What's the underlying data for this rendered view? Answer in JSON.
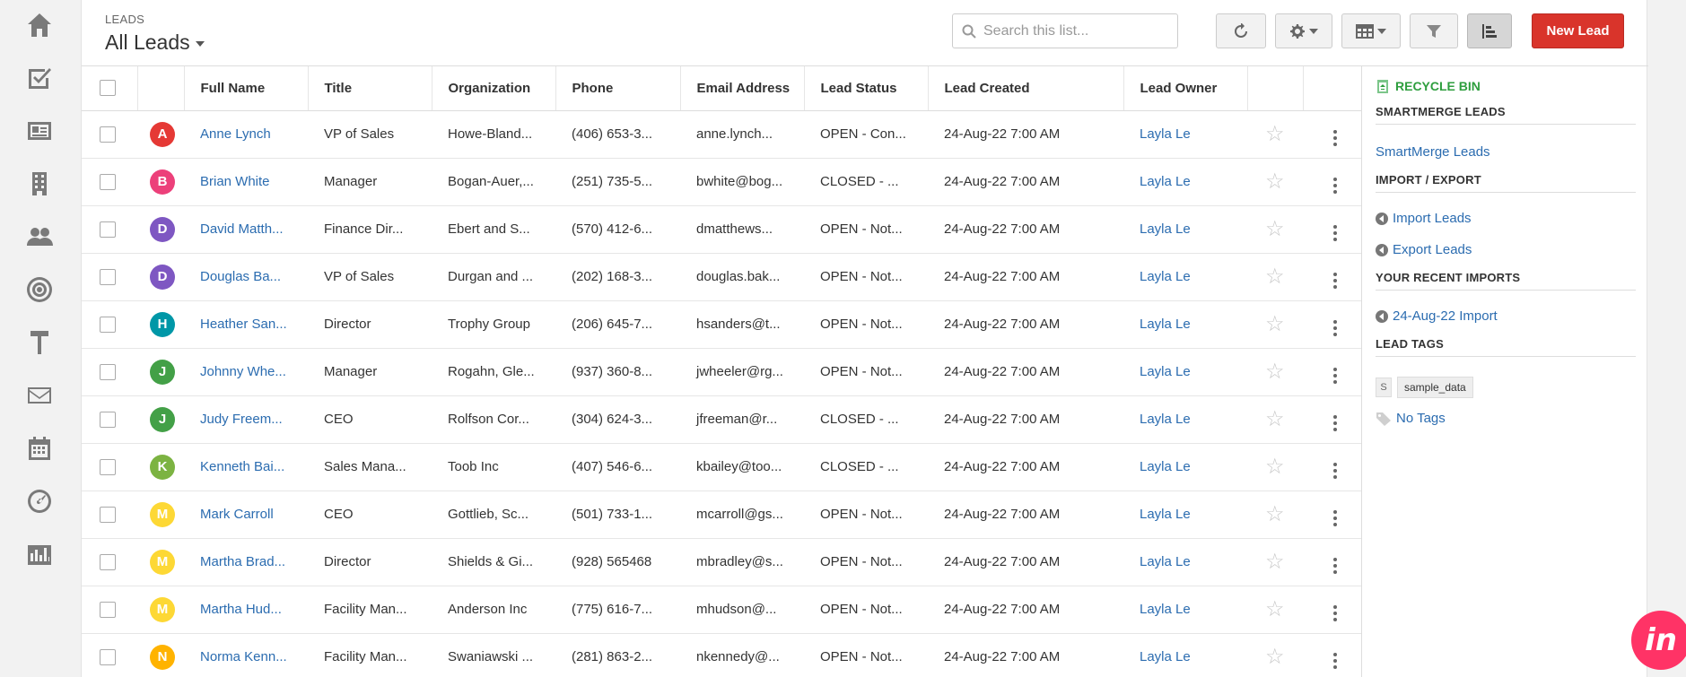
{
  "sidebar": {
    "items": [
      {
        "name": "home-icon"
      },
      {
        "name": "tasks-icon"
      },
      {
        "name": "contacts-icon"
      },
      {
        "name": "companies-icon"
      },
      {
        "name": "people-icon"
      },
      {
        "name": "target-icon"
      },
      {
        "name": "tools-icon"
      },
      {
        "name": "mail-icon"
      },
      {
        "name": "calendar-icon"
      },
      {
        "name": "dashboard-icon"
      },
      {
        "name": "reports-icon"
      }
    ]
  },
  "header": {
    "eyebrow": "LEADS",
    "view_title": "All Leads",
    "search_placeholder": "Search this list...",
    "new_lead_label": "New Lead"
  },
  "table": {
    "columns": [
      "Full Name",
      "Title",
      "Organization",
      "Phone",
      "Email Address",
      "Lead Status",
      "Lead Created",
      "Lead Owner"
    ],
    "rows": [
      {
        "initial": "A",
        "color": "#e53935",
        "name": "Anne Lynch",
        "title": "VP of Sales",
        "org": "Howe-Bland...",
        "phone": "(406) 653-3...",
        "email": "anne.lynch...",
        "status": "OPEN - Con...",
        "created": "24-Aug-22 7:00 AM",
        "owner": "Layla Le"
      },
      {
        "initial": "B",
        "color": "#ec407a",
        "name": "Brian White",
        "title": "Manager",
        "org": "Bogan-Auer,...",
        "phone": "(251) 735-5...",
        "email": "bwhite@bog...",
        "status": "CLOSED - ...",
        "created": "24-Aug-22 7:00 AM",
        "owner": "Layla Le"
      },
      {
        "initial": "D",
        "color": "#7e57c2",
        "name": "David Matth...",
        "title": "Finance Dir...",
        "org": "Ebert and S...",
        "phone": "(570) 412-6...",
        "email": "dmatthews...",
        "status": "OPEN - Not...",
        "created": "24-Aug-22 7:00 AM",
        "owner": "Layla Le"
      },
      {
        "initial": "D",
        "color": "#7e57c2",
        "name": "Douglas Ba...",
        "title": "VP of Sales",
        "org": "Durgan and ...",
        "phone": "(202) 168-3...",
        "email": "douglas.bak...",
        "status": "OPEN - Not...",
        "created": "24-Aug-22 7:00 AM",
        "owner": "Layla Le"
      },
      {
        "initial": "H",
        "color": "#0097a7",
        "name": "Heather San...",
        "title": "Director",
        "org": "Trophy Group",
        "phone": "(206) 645-7...",
        "email": "hsanders@t...",
        "status": "OPEN - Not...",
        "created": "24-Aug-22 7:00 AM",
        "owner": "Layla Le"
      },
      {
        "initial": "J",
        "color": "#43a047",
        "name": "Johnny Whe...",
        "title": "Manager",
        "org": "Rogahn, Gle...",
        "phone": "(937) 360-8...",
        "email": "jwheeler@rg...",
        "status": "OPEN - Not...",
        "created": "24-Aug-22 7:00 AM",
        "owner": "Layla Le"
      },
      {
        "initial": "J",
        "color": "#43a047",
        "name": "Judy Freem...",
        "title": "CEO",
        "org": "Rolfson Cor...",
        "phone": "(304) 624-3...",
        "email": "jfreeman@r...",
        "status": "CLOSED - ...",
        "created": "24-Aug-22 7:00 AM",
        "owner": "Layla Le"
      },
      {
        "initial": "K",
        "color": "#7cb342",
        "name": "Kenneth Bai...",
        "title": "Sales Mana...",
        "org": "Toob Inc",
        "phone": "(407) 546-6...",
        "email": "kbailey@too...",
        "status": "CLOSED - ...",
        "created": "24-Aug-22 7:00 AM",
        "owner": "Layla Le"
      },
      {
        "initial": "M",
        "color": "#fdd835",
        "name": "Mark Carroll",
        "title": "CEO",
        "org": "Gottlieb, Sc...",
        "phone": "(501) 733-1...",
        "email": "mcarroll@gs...",
        "status": "OPEN - Not...",
        "created": "24-Aug-22 7:00 AM",
        "owner": "Layla Le"
      },
      {
        "initial": "M",
        "color": "#fdd835",
        "name": "Martha Brad...",
        "title": "Director",
        "org": "Shields & Gi...",
        "phone": "(928) 565468",
        "email": "mbradley@s...",
        "status": "OPEN - Not...",
        "created": "24-Aug-22 7:00 AM",
        "owner": "Layla Le"
      },
      {
        "initial": "M",
        "color": "#fdd835",
        "name": "Martha Hud...",
        "title": "Facility Man...",
        "org": "Anderson Inc",
        "phone": "(775) 616-7...",
        "email": "mhudson@...",
        "status": "OPEN - Not...",
        "created": "24-Aug-22 7:00 AM",
        "owner": "Layla Le"
      },
      {
        "initial": "N",
        "color": "#ffb300",
        "name": "Norma Kenn...",
        "title": "Facility Man...",
        "org": "Swaniawski ...",
        "phone": "(281) 863-2...",
        "email": "nkennedy@...",
        "status": "OPEN - Not...",
        "created": "24-Aug-22 7:00 AM",
        "owner": "Layla Le"
      }
    ]
  },
  "rightpanel": {
    "recycle_bin": "RECYCLE BIN",
    "smartmerge_heading": "SMARTMERGE LEADS",
    "smartmerge_link": "SmartMerge Leads",
    "import_export_heading": "IMPORT / EXPORT",
    "import_link": "Import Leads",
    "export_link": "Export Leads",
    "recent_imports_heading": "YOUR RECENT IMPORTS",
    "recent_import_link": "24-Aug-22 Import",
    "lead_tags_heading": "LEAD TAGS",
    "tag_initial": "S",
    "tag_name": "sample_data",
    "no_tags_link": "No Tags"
  },
  "colors": {
    "accent": "#d9342b",
    "link": "#2b6cb0",
    "recycle_green": "#2e9e3e",
    "invision": "#ff3366"
  }
}
